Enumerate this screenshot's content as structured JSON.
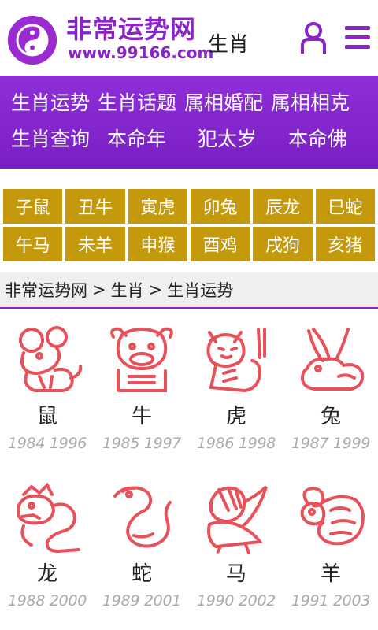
{
  "header": {
    "site_name": "非常运势网",
    "site_url": "www.99166.com",
    "section": "生肖"
  },
  "nav": {
    "row1": [
      "生肖运势",
      "生肖话题",
      "属相婚配",
      "属相相克"
    ],
    "row2": [
      "生肖查询",
      "本命年",
      "犯太岁",
      "本命佛"
    ]
  },
  "zodiac_grid": {
    "row1": [
      "子鼠",
      "丑牛",
      "寅虎",
      "卯兔",
      "辰龙",
      "巳蛇"
    ],
    "row2": [
      "午马",
      "未羊",
      "申猴",
      "酉鸡",
      "戌狗",
      "亥猪"
    ]
  },
  "breadcrumb": {
    "items": [
      "非常运势网",
      "生肖",
      "生肖运势"
    ],
    "separator": ">"
  },
  "animals": [
    {
      "name": "鼠",
      "years": "1984 1996",
      "icon": "rat-icon"
    },
    {
      "name": "牛",
      "years": "1985 1997",
      "icon": "ox-icon"
    },
    {
      "name": "虎",
      "years": "1986 1998",
      "icon": "tiger-icon"
    },
    {
      "name": "兔",
      "years": "1987 1999",
      "icon": "rabbit-icon"
    },
    {
      "name": "龙",
      "years": "1988 2000",
      "icon": "dragon-icon"
    },
    {
      "name": "蛇",
      "years": "1989 2001",
      "icon": "snake-icon"
    },
    {
      "name": "马",
      "years": "1990 2002",
      "icon": "horse-icon"
    },
    {
      "name": "羊",
      "years": "1991 2003",
      "icon": "goat-icon"
    }
  ],
  "colors": {
    "brand_purple": "#8a24c8",
    "nav_purple": "#8e2ed8",
    "zodiac_gold": "#c49a0c",
    "stamp_red": "#e8505a",
    "year_gray": "#aaaaaa"
  }
}
